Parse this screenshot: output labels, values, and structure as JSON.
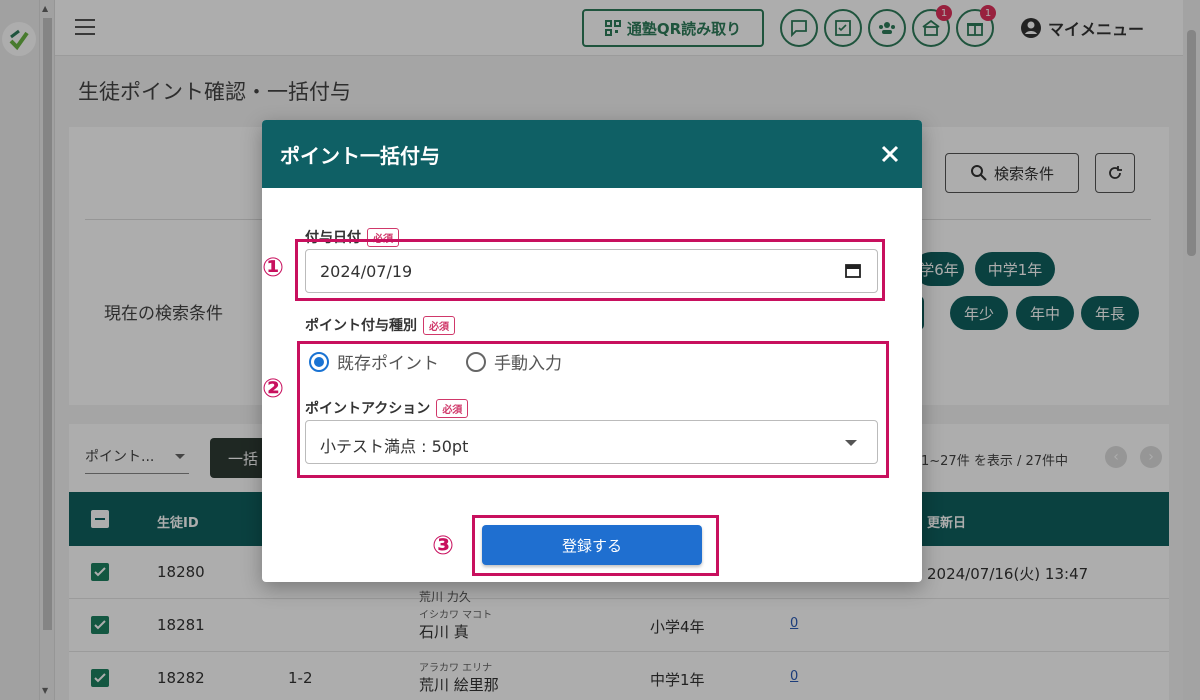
{
  "header": {
    "qr_button": "通塾QR読み取り",
    "my_menu": "マイメニュー",
    "badges": [
      "1",
      "1"
    ]
  },
  "page": {
    "title": "生徒ポイント確認・一括付与"
  },
  "search": {
    "button": "検索条件",
    "condition_label": "現在の検索条件",
    "chips": [
      "学6年",
      "中学1年",
      "年少",
      "年中",
      "年長"
    ]
  },
  "table": {
    "select_value": "ポイント...",
    "bulk_button": "一括",
    "count_text": "1~27件 を表示 / 27件中",
    "columns": {
      "id": "生徒ID",
      "updated": "更新日"
    },
    "rows": [
      {
        "id": "18280",
        "cls": "",
        "kana": "",
        "name": "荒川 力久",
        "grade": "",
        "points": "",
        "updated": "2024/07/16(火) 13:47"
      },
      {
        "id": "18281",
        "cls": "",
        "kana": "イシカワ マコト",
        "name": "石川 真",
        "grade": "小学4年",
        "points": "0",
        "updated": ""
      },
      {
        "id": "18282",
        "cls": "1-2",
        "kana": "アラカワ エリナ",
        "name": "荒川 絵里那",
        "grade": "中学1年",
        "points": "0",
        "updated": ""
      }
    ]
  },
  "modal": {
    "title": "ポイント一括付与",
    "date_label": "付与日付",
    "required": "必須",
    "date_value": "2024/07/19",
    "type_label": "ポイント付与種別",
    "radio_existing": "既存ポイント",
    "radio_manual": "手動入力",
    "action_label": "ポイントアクション",
    "action_value": "小テスト満点 : 50pt",
    "submit": "登録する"
  },
  "annotations": {
    "n1": "①",
    "n2": "②",
    "n3": "③"
  },
  "colors": {
    "header_teal": "#0f6065",
    "accent_green": "#2e7d5b",
    "primary_blue": "#1f6fd0",
    "annotation": "#c8105e"
  }
}
